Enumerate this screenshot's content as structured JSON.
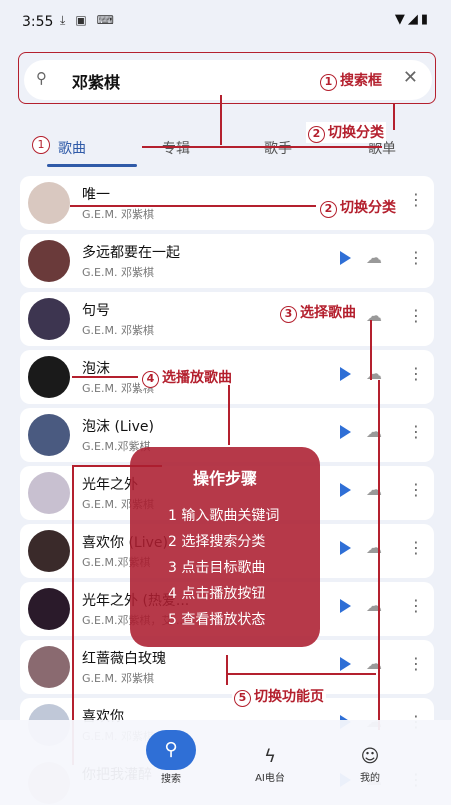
{
  "status": {
    "time": "3:55",
    "left_icons": [
      "download-icon",
      "image-icon",
      "keyboard-icon"
    ],
    "right_icons": [
      "wifi-icon",
      "signal-icon",
      "battery-icon"
    ]
  },
  "search": {
    "value": "邓紫棋"
  },
  "tabs": [
    {
      "label": "歌曲"
    },
    {
      "label": "专辑"
    },
    {
      "label": "歌手"
    },
    {
      "label": "歌单"
    }
  ],
  "songs": [
    {
      "title": "唯一",
      "artist": "G.E.M. 邓紫棋"
    },
    {
      "title": "多远都要在一起",
      "artist": "G.E.M. 邓紫棋"
    },
    {
      "title": "句号",
      "artist": "G.E.M. 邓紫棋"
    },
    {
      "title": "泡沫",
      "artist": "G.E.M. 邓紫棋"
    },
    {
      "title": "泡沫 (Live)",
      "artist": "G.E.M.邓紫棋"
    },
    {
      "title": "光年之外",
      "artist": "G.E.M. 邓紫棋"
    },
    {
      "title": "喜欢你 (Live)",
      "artist": "G.E.M.邓紫棋"
    },
    {
      "title": "光年之外 (热爱...",
      "artist": "G.E.M.邓紫棋，艾..."
    },
    {
      "title": "红蔷薇白玫瑰",
      "artist": "G.E.M. 邓紫棋"
    },
    {
      "title": "喜欢你",
      "artist": "G.E.M. 邓紫棋"
    },
    {
      "title": "你把我灌醉",
      "artist": ""
    }
  ],
  "annotations": {
    "a1": {
      "num": "1",
      "text": "搜索框"
    },
    "a2": {
      "num": "2",
      "text": "切换分类"
    },
    "a2b": {
      "num": "2",
      "text": "切换分类"
    },
    "a3": {
      "num": "3",
      "text": "选择歌曲"
    },
    "a4": {
      "num": "4",
      "text": "选播放歌曲"
    },
    "a5": {
      "num": "5",
      "text": "切换功能页"
    },
    "tab_num": "1"
  },
  "panel": {
    "title": "操作步骤",
    "steps": [
      "1 输入歌曲关键词",
      "2 选择搜索分类",
      "3 点击目标歌曲",
      "4 点击播放按钮",
      "5 查看播放状态"
    ]
  },
  "nav": [
    {
      "label": "搜索",
      "icon": "search-icon"
    },
    {
      "label": "AI电台",
      "icon": "lightning-icon"
    },
    {
      "label": "我的",
      "icon": "user-icon"
    }
  ],
  "colors": {
    "accent": "#2f6fd6",
    "annotation": "#b4202e"
  }
}
